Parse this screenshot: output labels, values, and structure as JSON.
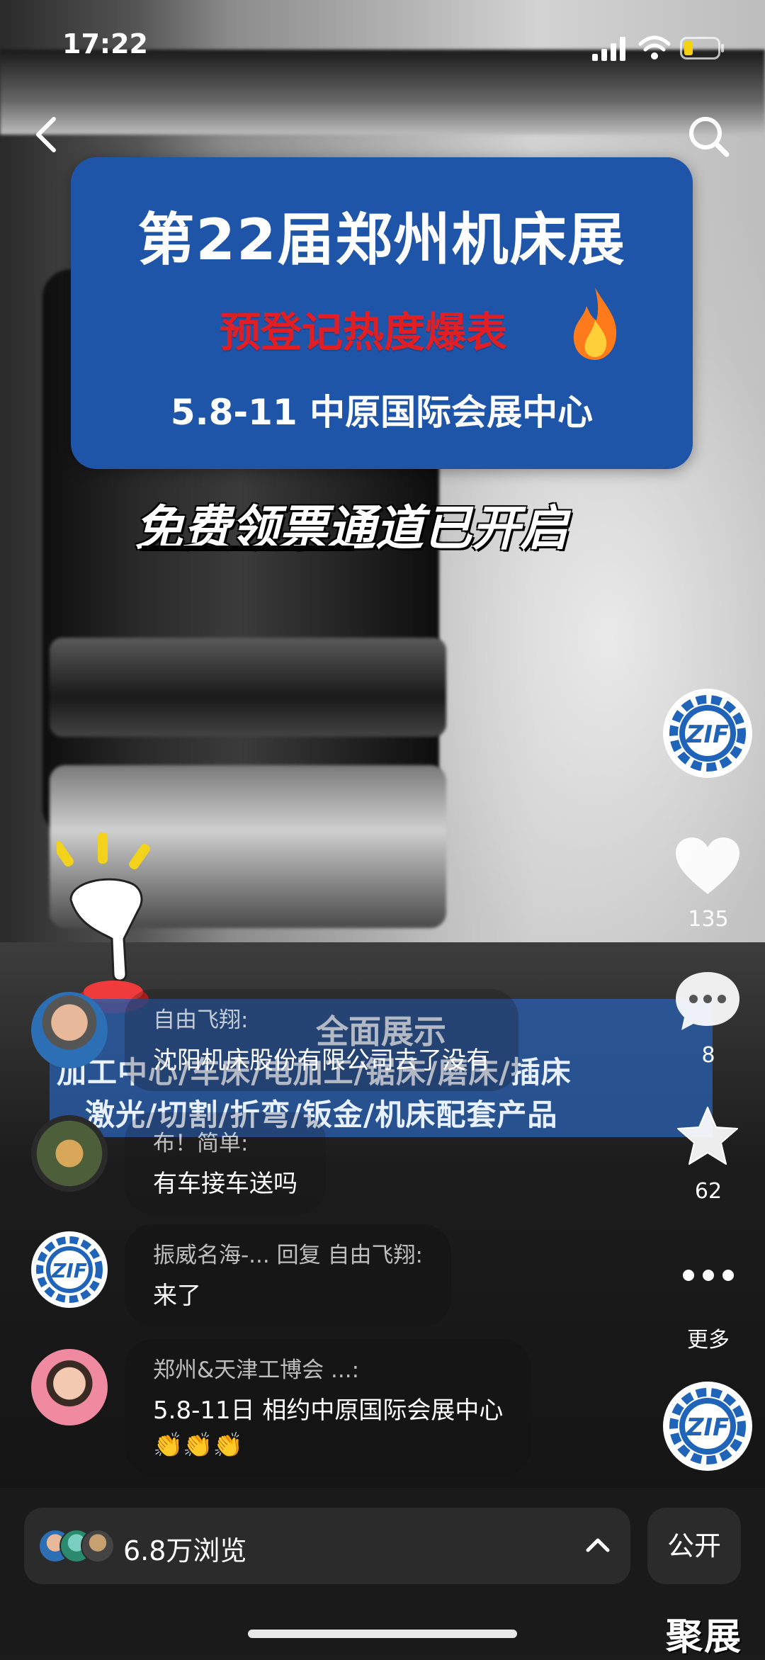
{
  "status_bar": {
    "time": "17:22"
  },
  "banner": {
    "title": "第22届郑州机床展",
    "subtitle": "预登记热度爆表",
    "date_venue": "5.8-11 中原国际会展中心",
    "bg_color": "#1f55a8",
    "subtitle_color": "#e21e25"
  },
  "overlay_headline": "免费领票通道已开启",
  "strip": {
    "line1": "全面展示",
    "line2": "加工中心/车床/电加工/锯床/磨床/插床",
    "line3": "激光/切割/折弯/钣金/机床配套产品"
  },
  "actions": {
    "like_count": "135",
    "comment_count": "8",
    "star_count": "62",
    "more_label": "更多"
  },
  "logo_text": "ZIF",
  "comments": [
    {
      "name": "自由飞翔:",
      "text": "沈阳机床股份有限公司去了没有"
    },
    {
      "name": "布！简单:",
      "text": "有车接车送吗"
    },
    {
      "name": "振威名海-... 回复 自由飞翔:",
      "text": "来了"
    },
    {
      "name": "郑州&天津工博会 ...:",
      "text": "5.8-11日  相约中原国际会展中心",
      "emoji": "👏👏👏"
    }
  ],
  "bottom": {
    "views": "6.8万浏览",
    "public_label": "公开"
  },
  "watermark": "聚展"
}
